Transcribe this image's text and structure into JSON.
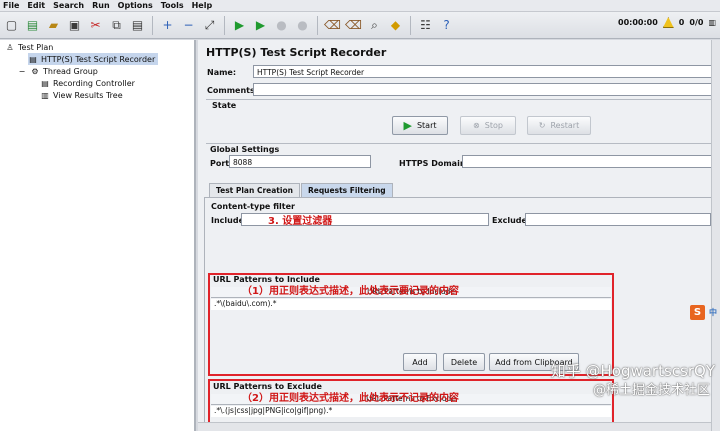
{
  "menu": [
    "File",
    "Edit",
    "Search",
    "Run",
    "Options",
    "Tools",
    "Help"
  ],
  "toolbar": {
    "icons": [
      "new-icon",
      "templates-icon",
      "open-icon",
      "save-icon",
      "cut-icon",
      "copy-icon",
      "paste-icon",
      "expand-icon",
      "collapse-icon",
      "toggle-icon",
      "start-icon",
      "start-no-pause-icon",
      "stop-icon",
      "shutdown-icon",
      "clear-icon",
      "clear-all-icon",
      "search-icon",
      "reset-search-icon",
      "function-helper-icon",
      "help-icon"
    ]
  },
  "status": {
    "time": "00:00:00",
    "warnings": "0",
    "threads": "0/0"
  },
  "tree": {
    "test_plan": "Test Plan",
    "recorder": "HTTP(S) Test Script Recorder",
    "thread_group": "Thread Group",
    "recording_controller": "Recording Controller",
    "view_results_tree": "View Results Tree"
  },
  "panel": {
    "title": "HTTP(S) Test Script Recorder",
    "name_label": "Name:",
    "name_value": "HTTP(S) Test Script Recorder",
    "comments_label": "Comments:",
    "comments_value": "",
    "state_label": "State",
    "start": "Start",
    "stop": "Stop",
    "restart": "Restart",
    "global_settings": "Global Settings",
    "port_label": "Port:",
    "port_value": "8088",
    "https_domains_label": "HTTPS Domains:",
    "https_domains_value": ""
  },
  "tabs": {
    "creation": "Test Plan Creation",
    "filtering": "Requests Filtering"
  },
  "filter": {
    "content_type_filter": "Content-type filter",
    "include_label": "Include:",
    "exclude_label": "Exclude:",
    "include_value": "",
    "exclude_value": "",
    "include_section": "URL Patterns to Include",
    "include_column": "URL Patterns to Include",
    "include_pattern": ".*\\(baidu\\.com).*",
    "add": "Add",
    "delete": "Delete",
    "add_clipboard": "Add from Clipboard",
    "exclude_section": "URL Patterns to Exclude",
    "exclude_column": "URL Patterns to Exclude",
    "exclude_pattern": ".*\\.(js|css|jpg|PNG|ico|gif|png).*"
  },
  "annotations": {
    "step3": "3. 设置过滤器",
    "note1": "（1）用正则表达式描述，此处表示要记录的内容",
    "note2": "（2）用正则表达式描述，此处表示不记录的内容"
  },
  "overlay": {
    "ime_label": "中",
    "watermark": "知乎 @HogwartscsrQY",
    "watermark_sub": "@稀土掘金技术社区"
  },
  "colors": {
    "annotation_red": "#e0232a",
    "selected": "#c5d5ec"
  }
}
